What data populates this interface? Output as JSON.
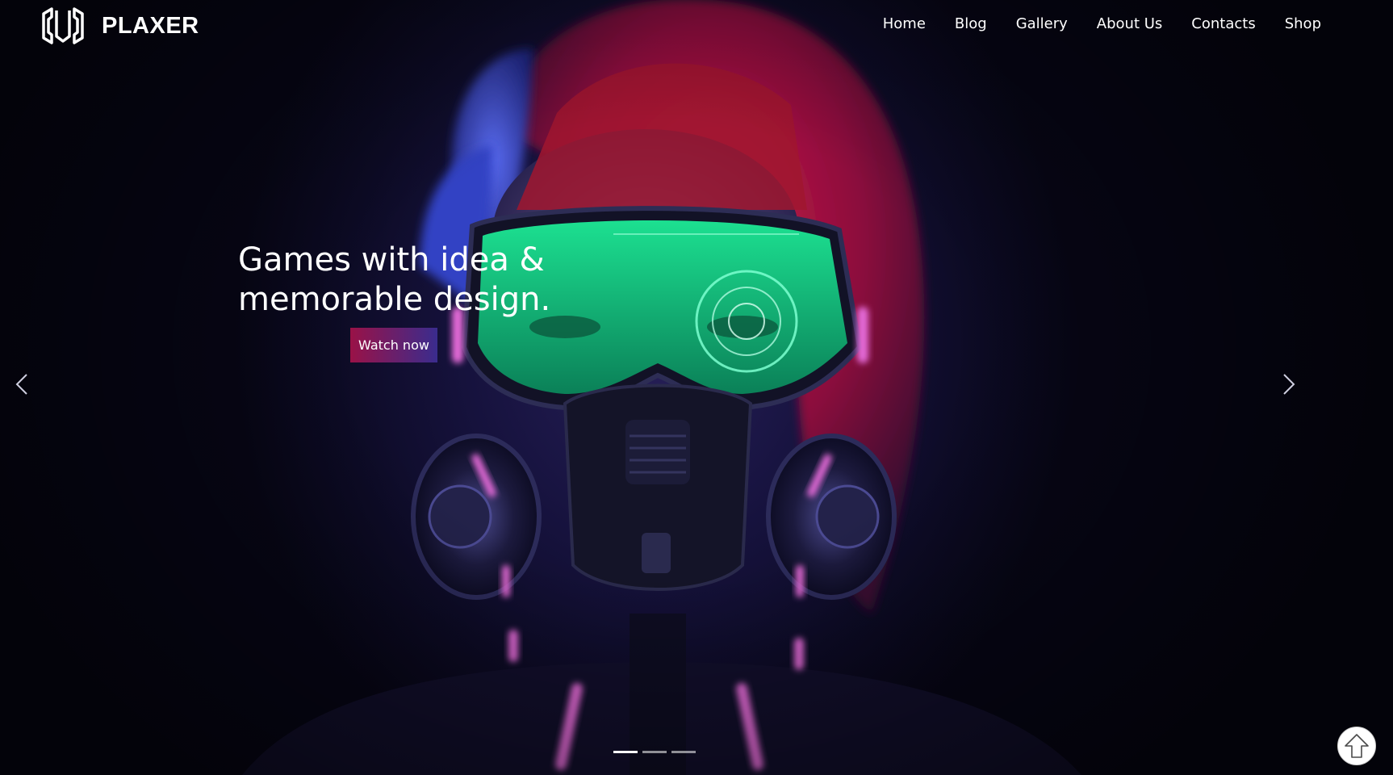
{
  "brand": {
    "name": "PLAXER",
    "logo_icon": "hexagon-u-logo-icon"
  },
  "nav": {
    "items": [
      {
        "label": "Home"
      },
      {
        "label": "Blog"
      },
      {
        "label": "Gallery"
      },
      {
        "label": "About Us"
      },
      {
        "label": "Contacts"
      },
      {
        "label": "Shop"
      }
    ]
  },
  "hero": {
    "headline_line1": "Games with idea &",
    "headline_line2": "memorable design.",
    "cta_label": "Watch now",
    "prev_icon": "chevron-left-icon",
    "next_icon": "chevron-right-icon",
    "slides_total": 3,
    "slide_active": 1
  },
  "scroll_top": {
    "icon": "arrow-up-icon"
  },
  "colors": {
    "background": "#0c0a22",
    "cta_start": "#9a1247",
    "cta_end": "#3a2c8e",
    "visor_green": "#1de08a",
    "neon_pink": "#e46bd8",
    "hair_red": "#c0163e",
    "hair_blue": "#3f4fd8"
  }
}
